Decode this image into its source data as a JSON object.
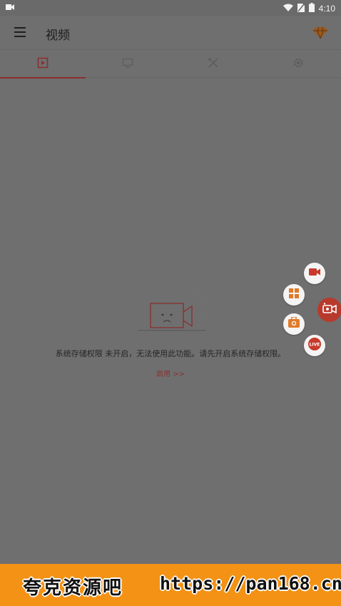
{
  "status_bar": {
    "time": "4:10",
    "icons": [
      "record-indicator-icon",
      "wifi-icon",
      "no-sim-icon",
      "battery-icon"
    ]
  },
  "app_bar": {
    "title": "视频",
    "menu_icon": "hamburger-menu-icon",
    "premium_icon": "diamond-icon"
  },
  "tabs": [
    {
      "icon": "video-play-icon",
      "active": true
    },
    {
      "icon": "screenshot-icon",
      "active": false
    },
    {
      "icon": "tools-icon",
      "active": false
    },
    {
      "icon": "settings-icon",
      "active": false
    }
  ],
  "empty_state": {
    "message": "系统存储权限 未开启，无法使用此功能。请先开启系统存储权限。",
    "enable_link": "启用 >>"
  },
  "floating_menu": {
    "items": [
      {
        "icon": "video-camera-icon"
      },
      {
        "icon": "grid-apps-icon"
      },
      {
        "icon": "toolbox-icon"
      },
      {
        "label": "LIVE",
        "icon": "live-badge-icon"
      }
    ],
    "main_icon": "record-camera-icon"
  },
  "watermark": {
    "left_text": "夸克资源吧",
    "right_text": "https://pan168.cn"
  },
  "colors": {
    "accent": "#8b2e2e",
    "fab_red": "#b83a2c",
    "banner": "#f39214"
  }
}
